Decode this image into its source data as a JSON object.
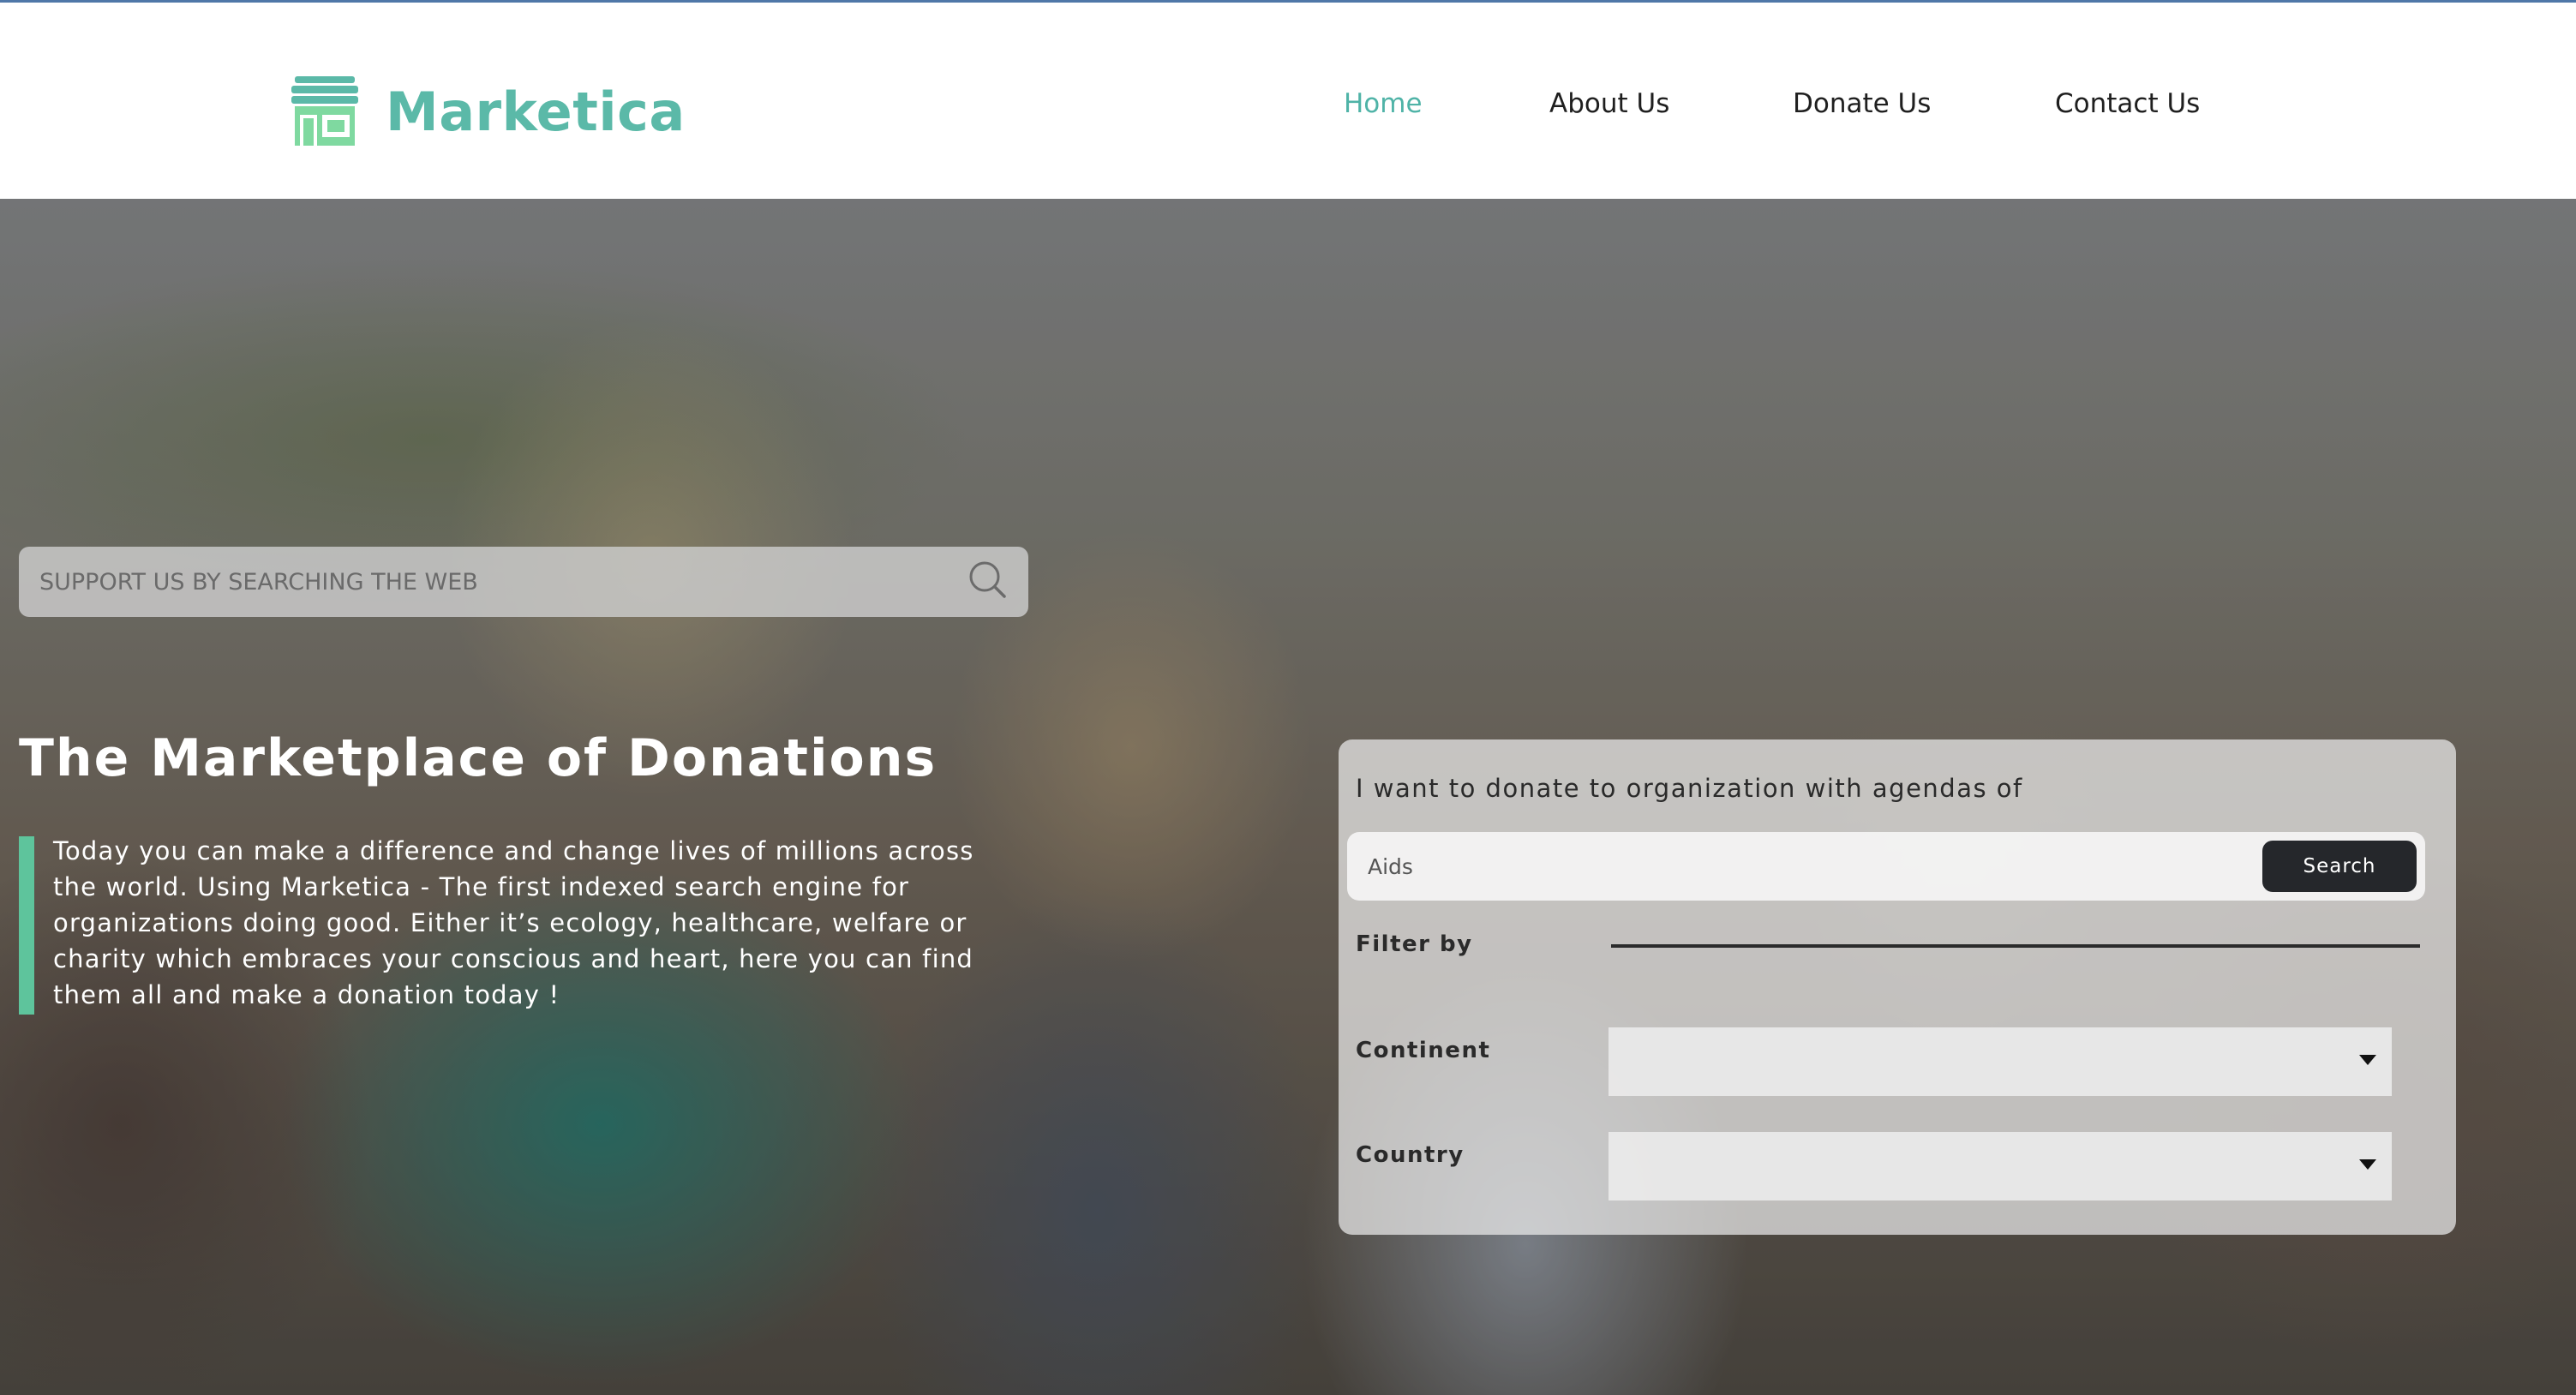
{
  "brand": {
    "name": "Marketica",
    "accent_color": "#5bb9a8",
    "icon": "storefront-icon"
  },
  "nav": {
    "items": [
      {
        "label": "Home",
        "active": true
      },
      {
        "label": "About Us",
        "active": false
      },
      {
        "label": "Donate Us",
        "active": false
      },
      {
        "label": "Contact Us",
        "active": false
      }
    ],
    "active_color": "#4fb3a7"
  },
  "web_search": {
    "placeholder": "SUPPORT US BY SEARCHING THE WEB",
    "icon": "search-icon"
  },
  "hero": {
    "title": "The Marketplace of Donations",
    "description": "Today you can make a difference and change lives of millions across the world. Using Marketica - The first indexed search engine for organizations doing good. Either it’s ecology, healthcare, welfare or charity which embraces your conscious and heart, here you can find them all and make a donation today !",
    "bar_color": "#5ec49c"
  },
  "donate_panel": {
    "intro": "I want to donate to organization with agendas of",
    "agenda_placeholder": "Aids",
    "search_button": "Search",
    "filter_label": "Filter by",
    "continent_label": "Continent",
    "continent_value": "",
    "country_label": "Country",
    "country_value": ""
  }
}
